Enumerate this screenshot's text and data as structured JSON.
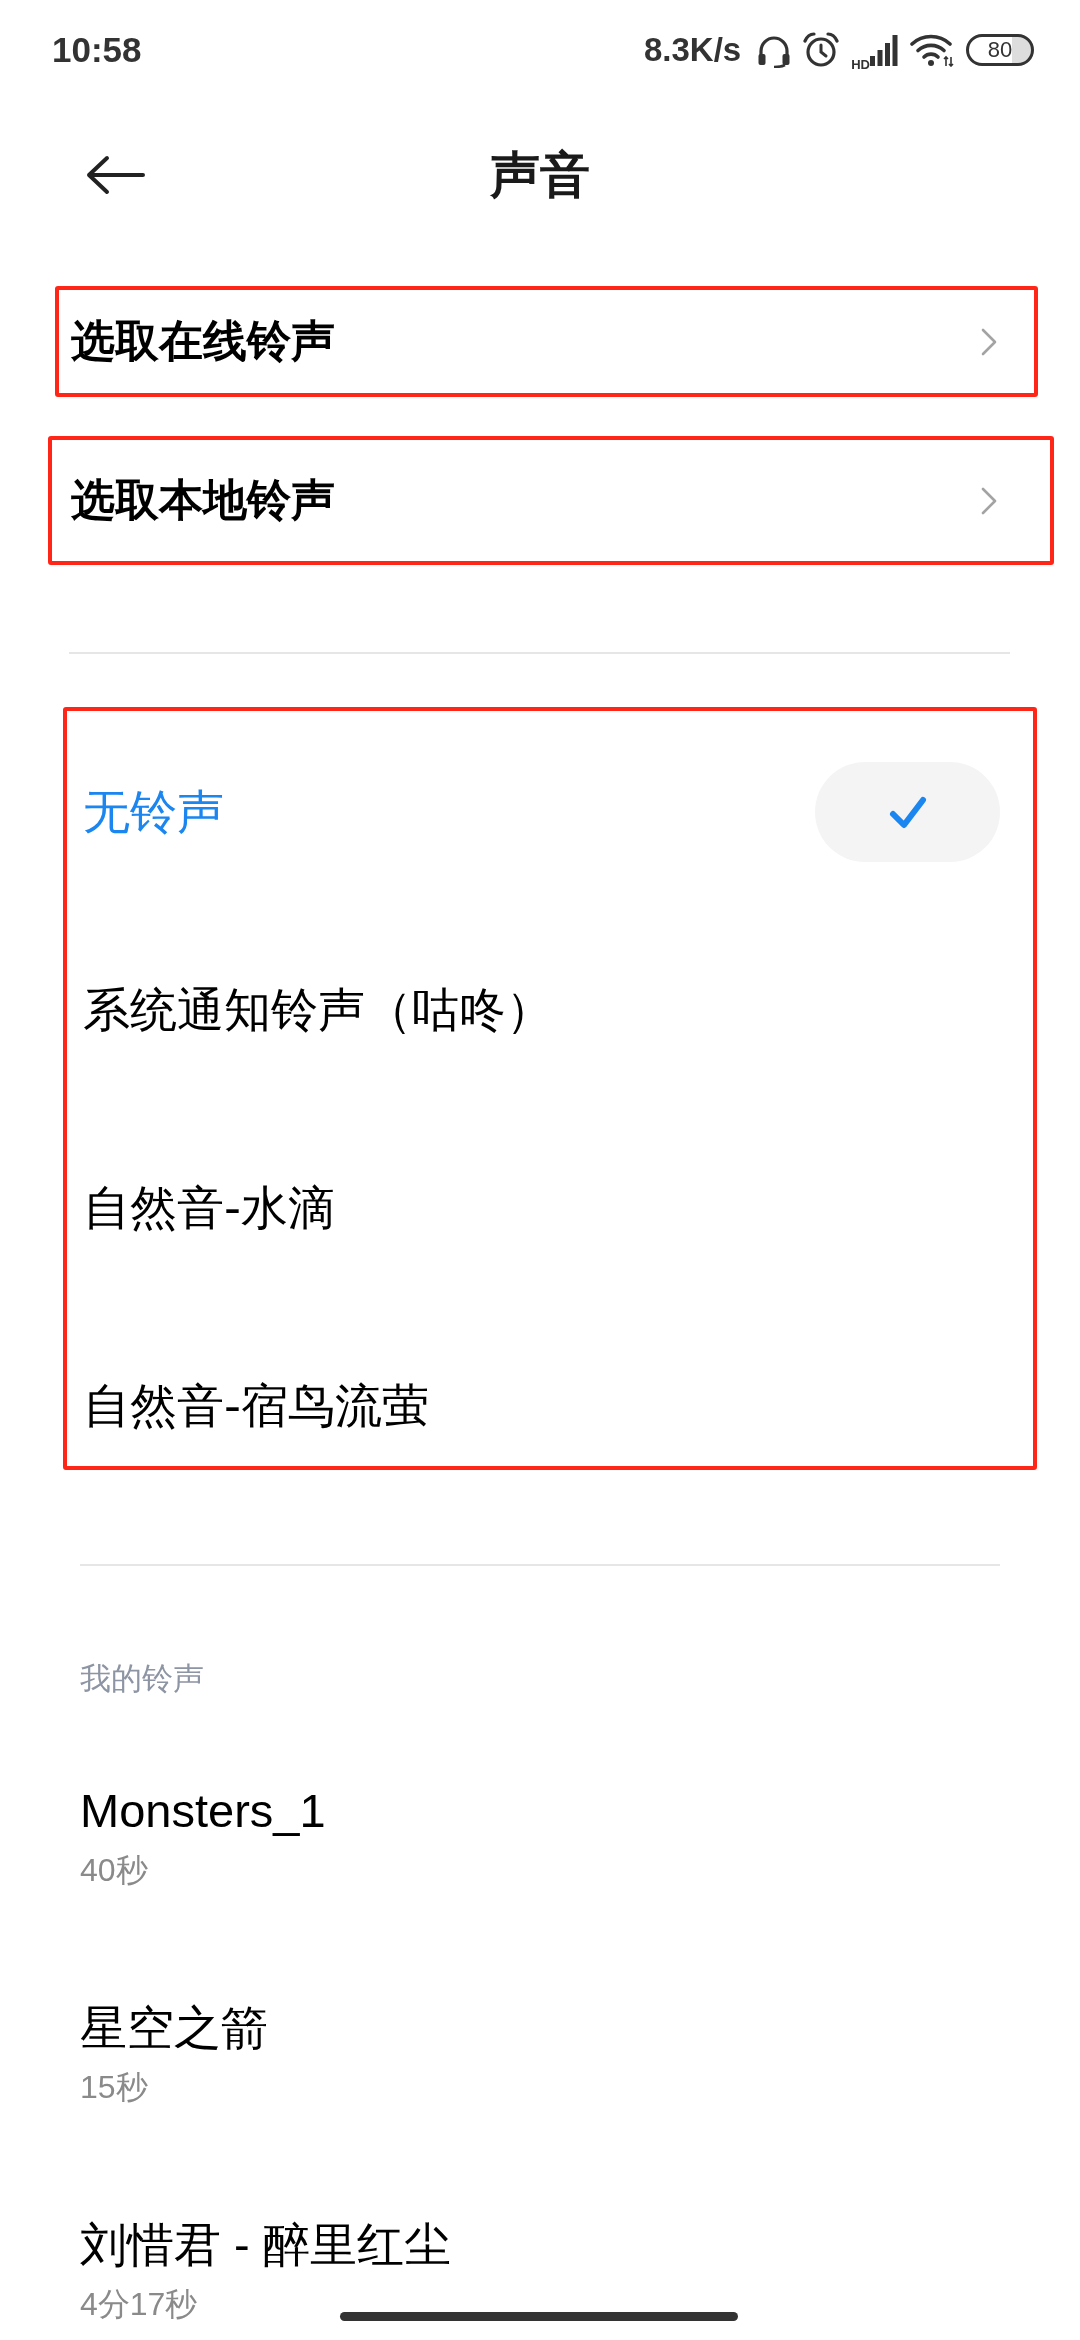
{
  "status_bar": {
    "time": "10:58",
    "net_speed": "8.3K/s",
    "network_label": "HD",
    "battery": "80"
  },
  "header": {
    "title": "声音"
  },
  "source_rows": [
    {
      "label": "选取在线铃声",
      "highlighted": true
    },
    {
      "label": "选取本地铃声",
      "highlighted": true
    }
  ],
  "system_ringtones": {
    "highlighted": true,
    "items": [
      {
        "name": "无铃声",
        "selected": true
      },
      {
        "name": "系统通知铃声（咕咚）",
        "selected": false
      },
      {
        "name": "自然音-水滴",
        "selected": false
      },
      {
        "name": "自然音-宿鸟流萤",
        "selected": false
      }
    ]
  },
  "my_ringtones": {
    "heading": "我的铃声",
    "items": [
      {
        "name": "Monsters_1",
        "duration": "40秒"
      },
      {
        "name": "星空之箭",
        "duration": "15秒"
      },
      {
        "name": "刘惜君 - 醉里红尘",
        "duration": "4分17秒"
      }
    ]
  }
}
